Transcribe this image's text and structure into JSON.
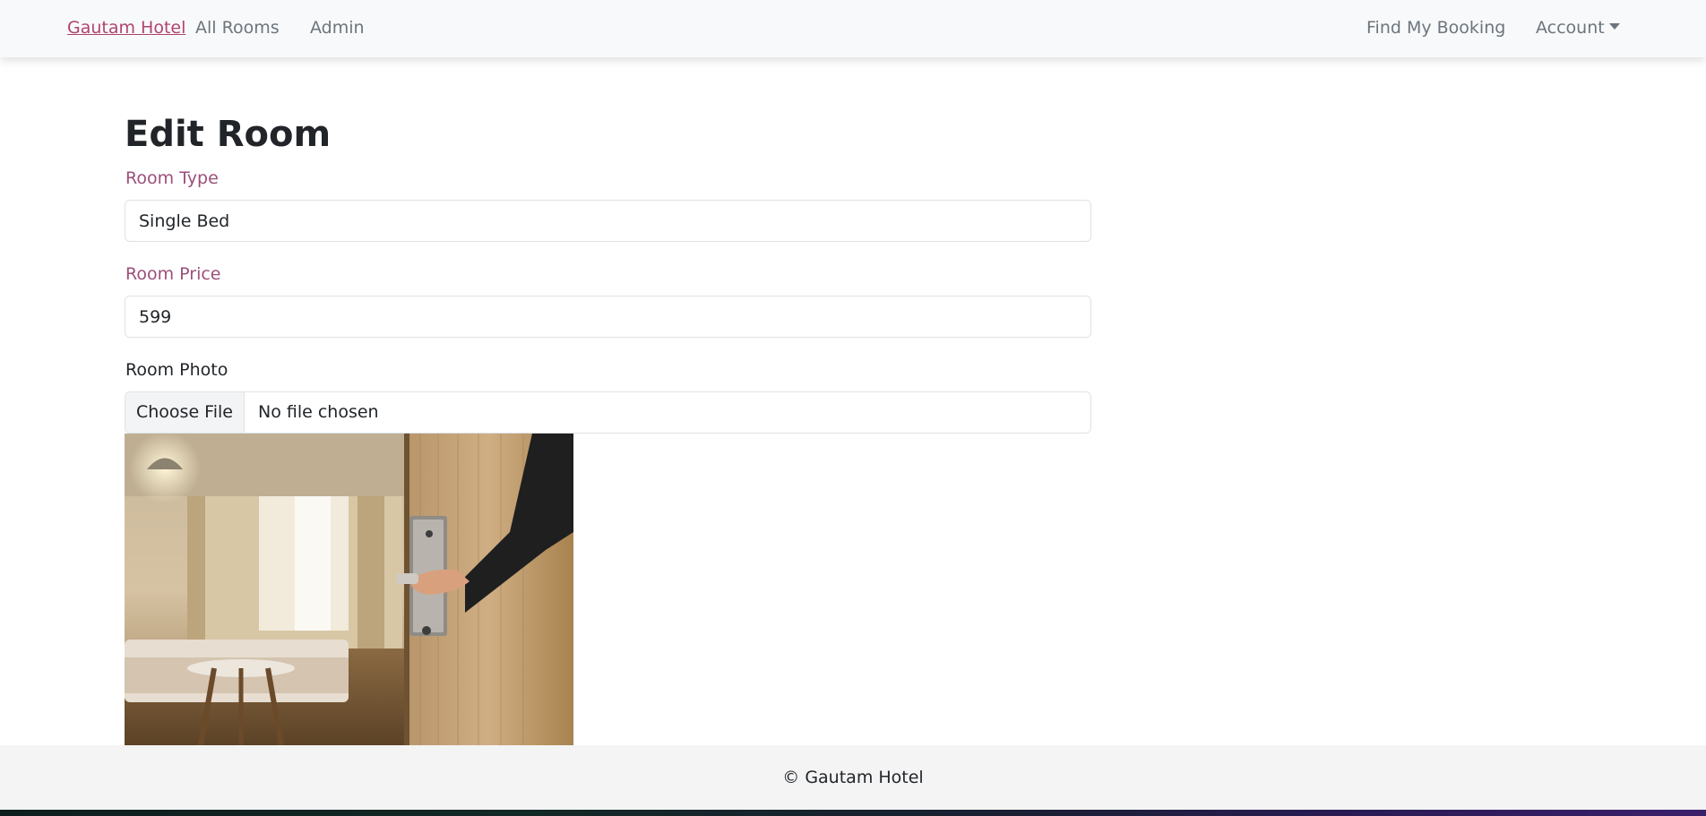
{
  "navbar": {
    "brand": "Gautam Hotel",
    "links": [
      "All Rooms",
      "Admin"
    ],
    "find_booking": "Find My Booking",
    "account": "Account"
  },
  "page": {
    "title": "Edit Room"
  },
  "form": {
    "room_type": {
      "label": "Room Type",
      "value": "Single Bed"
    },
    "room_price": {
      "label": "Room Price",
      "value": "599"
    },
    "room_photo": {
      "label": "Room Photo",
      "button_label": "Choose File",
      "status": "No file chosen"
    }
  },
  "footer": {
    "text": "© Gautam Hotel"
  },
  "colors": {
    "brand": "#b0446f",
    "label_accent": "#9b4f7a",
    "nav_bg": "#f8f9fa",
    "footer_bg": "#f4f4f4"
  }
}
